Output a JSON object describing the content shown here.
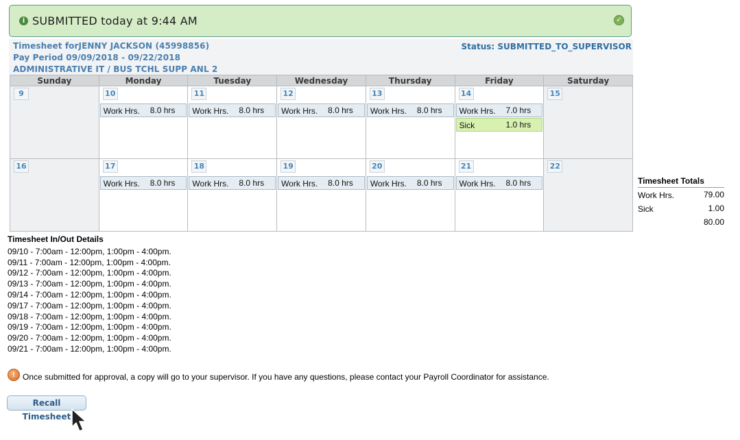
{
  "banner": {
    "title": "SUBMITTED today at 9:44 AM",
    "info_glyph": "i",
    "check_glyph": "✓"
  },
  "header": {
    "timesheet_for": "Timesheet forJENNY JACKSON (45998856)",
    "pay_period": "Pay Period 09/09/2018 - 09/22/2018",
    "department": "ADMINISTRATIVE IT / BUS TCHL SUPP ANL 2",
    "status": "Status: SUBMITTED_TO_SUPERVISOR"
  },
  "calendar": {
    "days": [
      "Sunday",
      "Monday",
      "Tuesday",
      "Wednesday",
      "Thursday",
      "Friday",
      "Saturday"
    ],
    "weeks": [
      [
        {
          "day": "9",
          "entries": []
        },
        {
          "day": "10",
          "entries": [
            {
              "label": "Work Hrs.",
              "value": "8.0 hrs"
            }
          ]
        },
        {
          "day": "11",
          "entries": [
            {
              "label": "Work Hrs.",
              "value": "8.0 hrs"
            }
          ]
        },
        {
          "day": "12",
          "entries": [
            {
              "label": "Work Hrs.",
              "value": "8.0 hrs"
            }
          ]
        },
        {
          "day": "13",
          "entries": [
            {
              "label": "Work Hrs.",
              "value": "8.0 hrs"
            }
          ]
        },
        {
          "day": "14",
          "entries": [
            {
              "label": "Work Hrs.",
              "value": "7.0 hrs"
            },
            {
              "label": "Sick",
              "value": "1.0 hrs"
            }
          ]
        },
        {
          "day": "15",
          "entries": []
        }
      ],
      [
        {
          "day": "16",
          "entries": []
        },
        {
          "day": "17",
          "entries": [
            {
              "label": "Work Hrs.",
              "value": "8.0 hrs"
            }
          ]
        },
        {
          "day": "18",
          "entries": [
            {
              "label": "Work Hrs.",
              "value": "8.0 hrs"
            }
          ]
        },
        {
          "day": "19",
          "entries": [
            {
              "label": "Work Hrs.",
              "value": "8.0 hrs"
            }
          ]
        },
        {
          "day": "20",
          "entries": [
            {
              "label": "Work Hrs.",
              "value": "8.0 hrs"
            }
          ]
        },
        {
          "day": "21",
          "entries": [
            {
              "label": "Work Hrs.",
              "value": "8.0 hrs"
            }
          ]
        },
        {
          "day": "22",
          "entries": []
        }
      ]
    ]
  },
  "totals": {
    "heading": "Timesheet Totals",
    "rows": [
      {
        "label": "Work Hrs.",
        "value": "79.00"
      },
      {
        "label": "Sick",
        "value": "1.00"
      },
      {
        "label": "",
        "value": "80.00"
      }
    ]
  },
  "details": {
    "heading": "Timesheet In/Out Details",
    "lines": [
      "09/10 - 7:00am - 12:00pm, 1:00pm - 4:00pm.",
      "09/11 - 7:00am - 12:00pm, 1:00pm - 4:00pm.",
      "09/12 - 7:00am - 12:00pm, 1:00pm - 4:00pm.",
      "09/13 - 7:00am - 12:00pm, 1:00pm - 4:00pm.",
      "09/14 - 7:00am - 12:00pm, 1:00pm - 4:00pm.",
      "09/17 - 7:00am - 12:00pm, 1:00pm - 4:00pm.",
      "09/18 - 7:00am - 12:00pm, 1:00pm - 4:00pm.",
      "09/19 - 7:00am - 12:00pm, 1:00pm - 4:00pm.",
      "09/20 - 7:00am - 12:00pm, 1:00pm - 4:00pm.",
      "09/21 - 7:00am - 12:00pm, 1:00pm - 4:00pm."
    ]
  },
  "notice": {
    "glyph": "!",
    "text": "Once submitted for approval, a copy will go to your supervisor. If you have any questions, please contact your Payroll Coordinator for assistance."
  },
  "actions": {
    "recall_label": "Recall Timesheet"
  }
}
